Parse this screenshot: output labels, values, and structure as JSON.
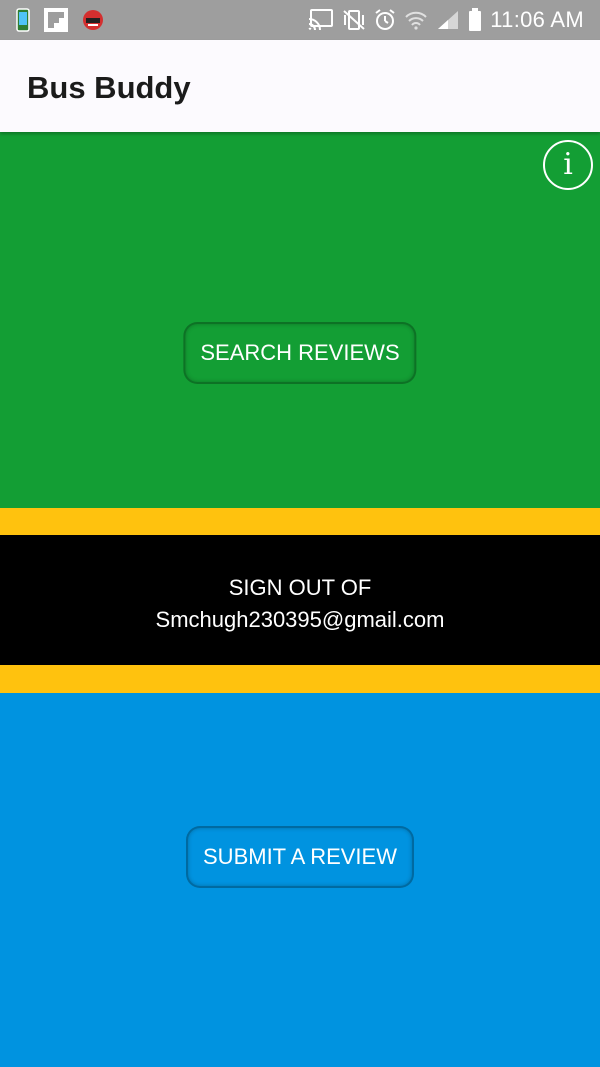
{
  "status_bar": {
    "time": "11:06 AM",
    "left_icons": [
      "phone-app-icon",
      "flipboard-icon",
      "notification-app-icon"
    ],
    "right_icons": [
      "cast-icon",
      "vibrate-mute-icon",
      "alarm-icon",
      "wifi-icon",
      "signal-icon",
      "battery-icon"
    ],
    "background": "#9e9e9e"
  },
  "app_bar": {
    "title": "Bus Buddy"
  },
  "search_panel": {
    "button_label": "SEARCH REVIEWS",
    "info_icon": "i",
    "color": "#139e34"
  },
  "sign_out": {
    "line1": "SIGN OUT OF",
    "line2": "Smchugh230395@gmail.com"
  },
  "submit_panel": {
    "button_label": "SUBMIT A REVIEW",
    "color": "#0093e0"
  },
  "colors": {
    "stripe": "#ffc20e",
    "app_bar": "#fcfafe"
  }
}
